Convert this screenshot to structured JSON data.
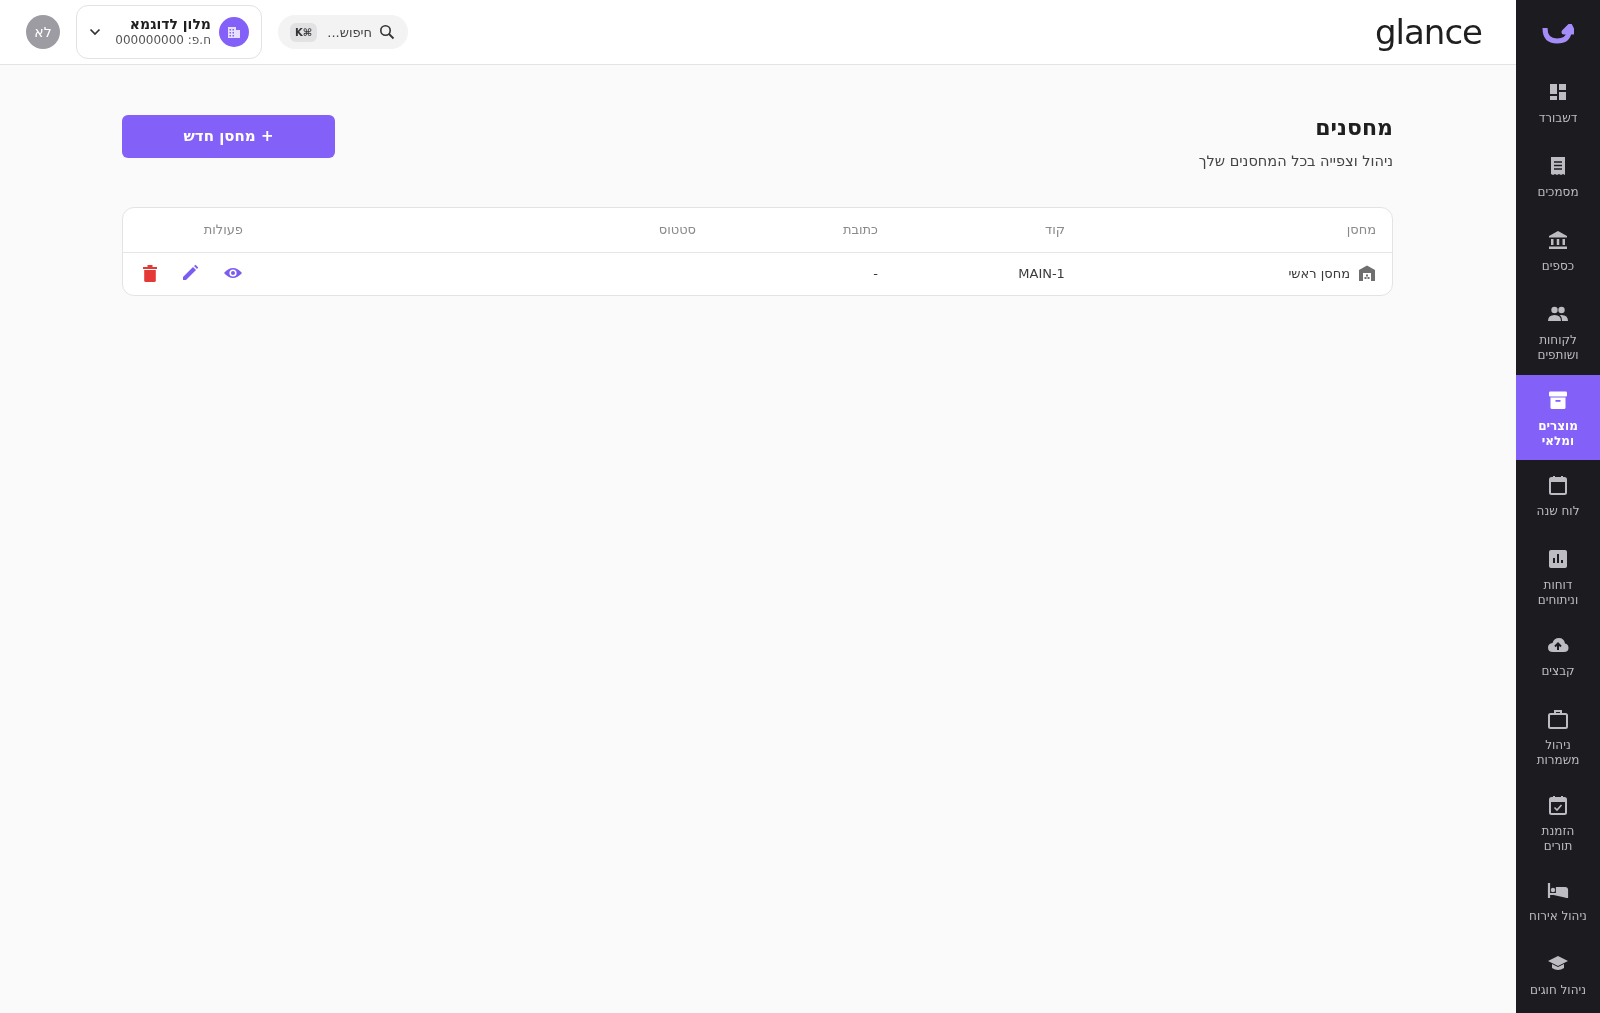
{
  "sidebar": {
    "items": [
      {
        "label": "דשבורד",
        "selected": false
      },
      {
        "label": "מסמכים",
        "selected": false
      },
      {
        "label": "כספים",
        "selected": false
      },
      {
        "label": "לקוחות ושותפים",
        "selected": false
      },
      {
        "label": "מוצרים ומלאי",
        "selected": true
      },
      {
        "label": "לוח שנה",
        "selected": false
      },
      {
        "label": "דוחות וניתוחים",
        "selected": false
      },
      {
        "label": "קבצים",
        "selected": false
      },
      {
        "label": "ניהול משמרות",
        "selected": false
      },
      {
        "label": "הזמנת תורים",
        "selected": false
      },
      {
        "label": "ניהול אירוח",
        "selected": false
      },
      {
        "label": "ניהול חוגים",
        "selected": false
      }
    ]
  },
  "topbar": {
    "logo": "glance",
    "search": {
      "placeholder": "חיפוש...",
      "shortcut": "⌘K"
    },
    "company": {
      "name": "מלון לדוגמא",
      "id_line": "ח.פ: 000000000"
    },
    "avatar": "לא"
  },
  "page": {
    "title": "מחסנים",
    "subtitle": "ניהול וצפייה בכל המחסנים שלך",
    "new_button": "+ מחסן חדש"
  },
  "table": {
    "columns": [
      "מחסן",
      "קוד",
      "כתובת",
      "סטטוס",
      "פעולות"
    ],
    "rows": [
      {
        "name": "מחסן ראשי",
        "code": "MAIN-1",
        "address": "-"
      }
    ]
  }
}
